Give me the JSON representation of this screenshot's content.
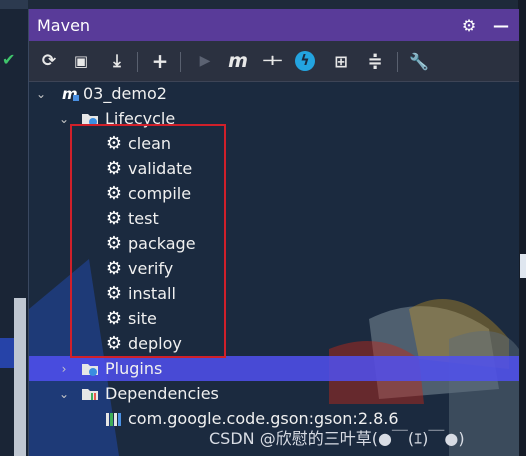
{
  "panel": {
    "title": "Maven",
    "title_buttons": [
      {
        "name": "settings-gear-icon",
        "glyph": "⚙"
      },
      {
        "name": "minimize-icon",
        "glyph": "—"
      }
    ]
  },
  "toolbar": {
    "buttons": [
      {
        "name": "reload-icon",
        "glyph": "⟳"
      },
      {
        "name": "add-folder-icon",
        "glyph": "▣"
      },
      {
        "name": "download-icon",
        "glyph": "⤓"
      },
      {
        "name": "add-icon",
        "glyph": "+"
      },
      {
        "name": "run-icon",
        "glyph": "▶"
      },
      {
        "name": "maven-goal-icon",
        "glyph": "m"
      },
      {
        "name": "toggle-offline-icon",
        "glyph": "⊣⊢"
      },
      {
        "name": "skip-tests-icon",
        "glyph": "ϟ"
      },
      {
        "name": "show-dependencies-icon",
        "glyph": "⊞"
      },
      {
        "name": "collapse-all-icon",
        "glyph": "≑"
      },
      {
        "name": "maven-settings-icon",
        "glyph": "🔧"
      }
    ]
  },
  "tree": {
    "project": "03_demo2",
    "lifecycle_label": "Lifecycle",
    "lifecycle": [
      "clean",
      "validate",
      "compile",
      "test",
      "package",
      "verify",
      "install",
      "site",
      "deploy"
    ],
    "plugins_label": "Plugins",
    "dependencies_label": "Dependencies",
    "dependency": "com.google.code.gson:gson:2.8.6"
  },
  "watermark": "CSDN @欣慰的三叶草(●￣(ｴ)￣●)",
  "colors": {
    "title_bar": "#593b99",
    "selection": "#5050f0",
    "highlight_box": "#d0202a"
  }
}
